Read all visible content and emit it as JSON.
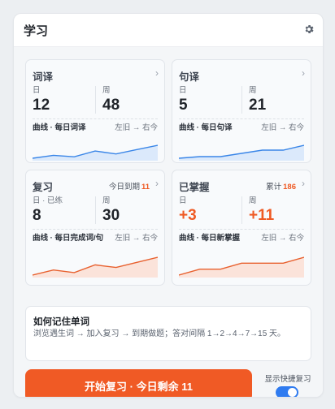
{
  "header": {
    "title": "学习"
  },
  "icons": {
    "settings": "gear-icon",
    "chevron": "chevron-right-icon",
    "cursor": "mouse-pointer-icon"
  },
  "colors": {
    "accent": "#f05a25",
    "blue_line": "#3a86e8",
    "blue_fill": "#dbe9fb",
    "orange_line": "#e8602e",
    "orange_fill": "#fbe3da",
    "toggle": "#2f7bf0"
  },
  "cards": [
    {
      "title": "词译",
      "stat1_label": "日",
      "stat1_value": "12",
      "stat2_label": "周",
      "stat2_value": "48",
      "caption": "曲线 · 每日词译",
      "range": "左旧 → 右今",
      "trend": [
        6,
        8,
        7,
        11,
        9,
        12,
        15
      ]
    },
    {
      "title": "句译",
      "stat1_label": "日",
      "stat1_value": "5",
      "stat2_label": "周",
      "stat2_value": "21",
      "caption": "曲线 · 每日句译",
      "range": "左旧 → 右今",
      "trend": [
        3,
        4,
        4,
        6,
        8,
        8,
        11
      ]
    },
    {
      "title": "复习",
      "due_label": "今日到期",
      "due_value": "11",
      "stat1_label": "日 · 已练",
      "stat1_value": "8",
      "stat2_label": "周",
      "stat2_value": "30",
      "caption": "曲线 · 每日完成词/句",
      "range": "左旧 → 右今",
      "trend": [
        5,
        7,
        6,
        9,
        8,
        10,
        12
      ]
    },
    {
      "title": "已掌握",
      "due_label": "累计",
      "due_value": "186",
      "stat1_label": "日",
      "stat1_value": "+3",
      "stat2_label": "周",
      "stat2_value": "+11",
      "caption": "曲线 · 每日新掌握",
      "range": "左旧 → 右今",
      "trend": [
        1,
        2,
        2,
        3,
        3,
        3,
        4
      ]
    }
  ],
  "tip": {
    "title": "如何记住单词",
    "body": "浏览遇生词 → 加入复习 → 到期做题；答对间隔 1→2→4→7→15 天。"
  },
  "start_button": {
    "label": "开始复习 · 今日剩余 11"
  },
  "quick_review": {
    "label": "显示快捷复习",
    "enabled": true
  }
}
